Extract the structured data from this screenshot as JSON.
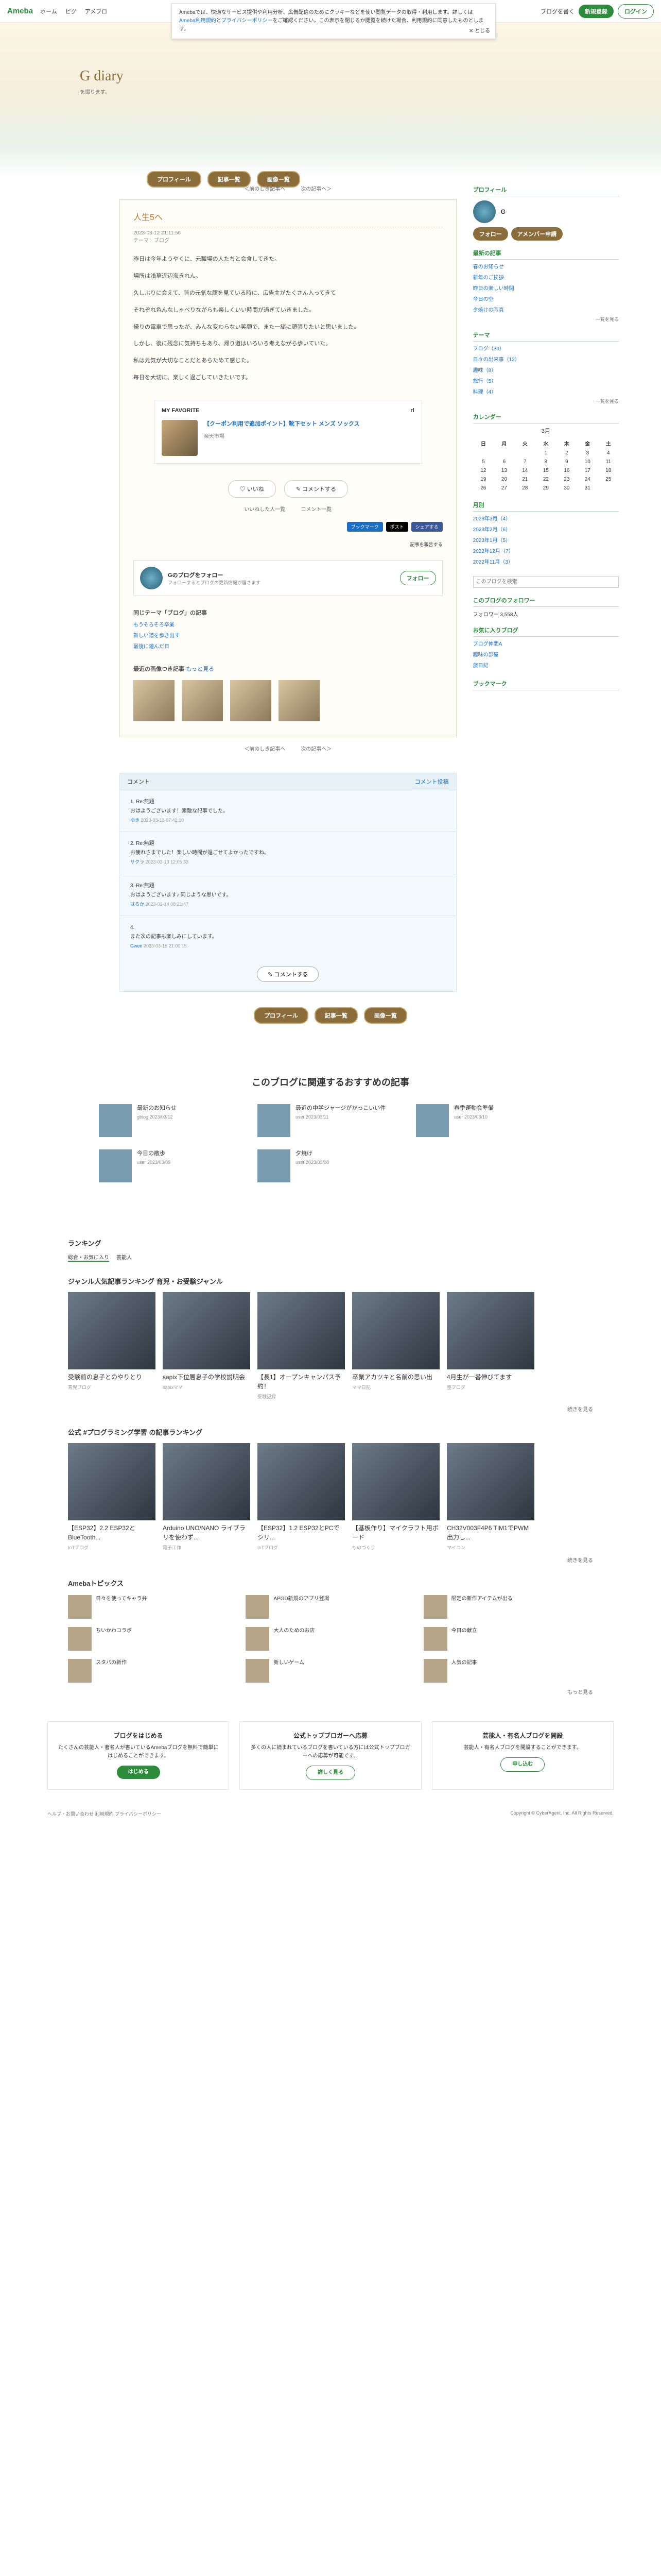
{
  "topbar": {
    "logo": "Ameba",
    "nav": [
      "ホーム",
      "ピグ",
      "アメブロ"
    ],
    "blog_btn": "ブログを書く",
    "register": "新規登録",
    "login": "ログイン"
  },
  "cookie": {
    "text": "Amebaでは、快適なサービス提供や利用分析、広告配信のためにクッキーなどを使い閲覧データの取得・利用します。詳しくは",
    "link1": "Ameba利用規約",
    "mid": "と",
    "link2": "プライバシーポリシー",
    "tail": "をご確認ください。この表示を閉じるか閲覧を続けた場合、利用規約に同意したものとします。",
    "close": "とじる"
  },
  "header": {
    "title": "G diary",
    "sub": "を綴ります。",
    "btns": [
      "プロフィール",
      "記事一覧",
      "画像一覧"
    ]
  },
  "nav": {
    "prev": "＜前のしき記事へ",
    "next": "次の記事へ＞"
  },
  "article": {
    "title": "人生5へ",
    "date": "2023-03-12 21:11:56",
    "theme": "テーマ：ブログ",
    "paras": [
      "昨日は今年ようやくに、元職場の人たちと会食してきた。",
      "場所は浅草近辺海きれん。",
      "久しぶりに会えて、皆の元気な顔を見ている時に、広告主がたくさん入ってきて",
      "それぞれ色んなしゃべりながらも楽しくいい時間が過ぎていきました。",
      "帰りの電車で思ったが、みんな変わらない笑顔で、また一緒に頑張りたいと思いました。",
      "しかし、後に残念に気持ちもあり、帰り道はいろいろ考えながら歩いていた。",
      "私は元気が大切なことだとあらためて感じた。",
      "毎日を大切に、楽しく過ごしていきたいです。"
    ]
  },
  "card": {
    "label": "MY FAVORITE",
    "brand": "rl",
    "title": "【クーポン利用で追加ポイント】靴下セット メンズ ソックス",
    "price": "楽天市場"
  },
  "actions": {
    "like": "いいね",
    "comment": "コメントする",
    "likers": "いいねした人一覧",
    "comments_count": "コメント一覧"
  },
  "share": {
    "items": [
      "ブックマーク",
      "ポスト",
      "シェアする"
    ],
    "report": "記事を報告する"
  },
  "follow": {
    "name": "Gのブログをフォロー",
    "desc": "フォローするとブログの更新情報が届きます",
    "btn": "フォロー"
  },
  "same_theme": {
    "head": "同じテーマ「ブログ」の記事",
    "items": [
      "もうそろそろ卒業",
      "新しい道を歩き出す",
      "最後に遊んだ日"
    ]
  },
  "popular": {
    "head": "最近の画像つき記事",
    "more": "もっと見る"
  },
  "comments": {
    "head": "コメント",
    "link": "コメント投稿",
    "items": [
      {
        "no": "1. Re:無題",
        "text": "おはようございます！素敵な記事でした。",
        "meta": "2023-03-13 07:42:10",
        "name": "ゆき"
      },
      {
        "no": "2. Re:無題",
        "text": "お疲れさまでした！楽しい時間が過ごせてよかったですね。",
        "meta": "2023-03-13 12:05:33",
        "name": "サクラ"
      },
      {
        "no": "3. Re:無題",
        "text": "おはようございます♪ 同じような思いです。",
        "meta": "2023-03-14 08:21:47",
        "name": "はるか"
      },
      {
        "no": "4.",
        "text": "また次の記事も楽しみにしています。",
        "meta": "2023-03-16 21:00:15",
        "name": "Gwen"
      }
    ],
    "btn": "コメントする"
  },
  "sidebar": {
    "profile_h": "プロフィール",
    "profile_name": "G",
    "follow_btn": "フォロー",
    "amember": "アメンバー申請",
    "articles_h": "最新の記事",
    "articles": [
      "春のお知らせ",
      "新年のご挨拶",
      "昨日の楽しい時間",
      "今日の空",
      "夕焼けの写真"
    ],
    "themes_h": "テーマ",
    "themes": [
      "ブログ（30）",
      "日々の出来事（12）",
      "趣味（8）",
      "旅行（5）",
      "料理（4）"
    ],
    "cal_h": "カレンダー",
    "cal_month": "3月",
    "cal_days": [
      "日",
      "月",
      "火",
      "水",
      "木",
      "金",
      "土"
    ],
    "months_h": "月別",
    "months": [
      "2023年3月（4）",
      "2023年2月（6）",
      "2023年1月（5）",
      "2022年12月（7）",
      "2022年11月（3）"
    ],
    "search_h": "このブログを検索",
    "search_ph": "このブログを検索",
    "followers_h": "このブログのフォロワー",
    "followers": "フォロワー 3,558人",
    "fav_h": "お気に入りブログ",
    "fav": [
      "ブログ仲間A",
      "趣味の部屋",
      "旅日記"
    ],
    "bookmark_h": "ブックマーク",
    "more": "一覧を見る"
  },
  "rec": {
    "head": "このブログに関連するおすすめの記事",
    "items": [
      {
        "t": "最新のお知らせ",
        "a": "gblog 2023/03/12"
      },
      {
        "t": "最近の中学ジャージがかっこいい件",
        "a": "user 2023/03/11"
      },
      {
        "t": "春季運動会準備",
        "a": "user 2023/03/10"
      },
      {
        "t": "今日の散歩",
        "a": "user 2023/03/09"
      },
      {
        "t": "夕焼け",
        "a": "user 2023/03/08"
      }
    ]
  },
  "ranking": {
    "head": "ランキング",
    "tabs": [
      "総合・お気に入り",
      "芸能人"
    ]
  },
  "genre": {
    "head": "ジャンル人気記事ランキング 育児・お受験ジャンル",
    "items": [
      {
        "t": "受験前の息子とのやりとり",
        "a": "育児ブログ"
      },
      {
        "t": "sapix下位層息子の学校説明会",
        "a": "sapixママ"
      },
      {
        "t": "【長1】オープンキャンパス予約！",
        "a": "受験記録"
      },
      {
        "t": "卒業アカツキと名前の思い出",
        "a": "ママ日記"
      },
      {
        "t": "4月生が一番伸びてます",
        "a": "塾ブログ"
      }
    ],
    "more": "続きを見る"
  },
  "official": {
    "head": "公式 #プログラミング学習 の記事ランキング",
    "items": [
      {
        "t": "【ESP32】2.2 ESP32とBlueTooth...",
        "a": "IoTブログ"
      },
      {
        "t": "Arduino UNO/NANO ライブラリを使わず...",
        "a": "電子工作"
      },
      {
        "t": "【ESP32】1.2 ESP32とPCでシリ...",
        "a": "IoTブログ"
      },
      {
        "t": "【基板作り】マイクラフト用ボード",
        "a": "ものづくり"
      },
      {
        "t": "CH32V003F4P6 TIM1でPWM出力し...",
        "a": "マイコン"
      }
    ],
    "more": "続きを見る"
  },
  "topics": {
    "head": "Amebaトピックス",
    "items": [
      "日々を使ってキャラ弁",
      "APGD新規のアプリ登場",
      "限定の新作アイテムが出る",
      "ちいかわコラボ",
      "大人のためのお店",
      "今日の献立",
      "スタバの新作",
      "新しいゲーム",
      "人気の記事"
    ],
    "more": "もっと見る"
  },
  "cta": [
    {
      "h": "ブログをはじめる",
      "d": "たくさんの芸能人・著名人が書いているAmebaブログを無料で簡単にはじめることができます。",
      "b": "はじめる"
    },
    {
      "h": "公式トップブロガーへ応募",
      "d": "多くの人に読まれているブログを書いている方には公式トップブロガーへの応募が可能です。",
      "b": "詳しく見る"
    },
    {
      "h": "芸能人・有名人ブログを開設",
      "d": "芸能人・有名人ブログを開設することができます。",
      "b": "申し込む"
    }
  ],
  "footer": {
    "left": "ヘルプ・お問い合わせ  利用規約  プライバシーポリシー",
    "right": "Copyright © CyberAgent, Inc. All Rights Reserved."
  }
}
